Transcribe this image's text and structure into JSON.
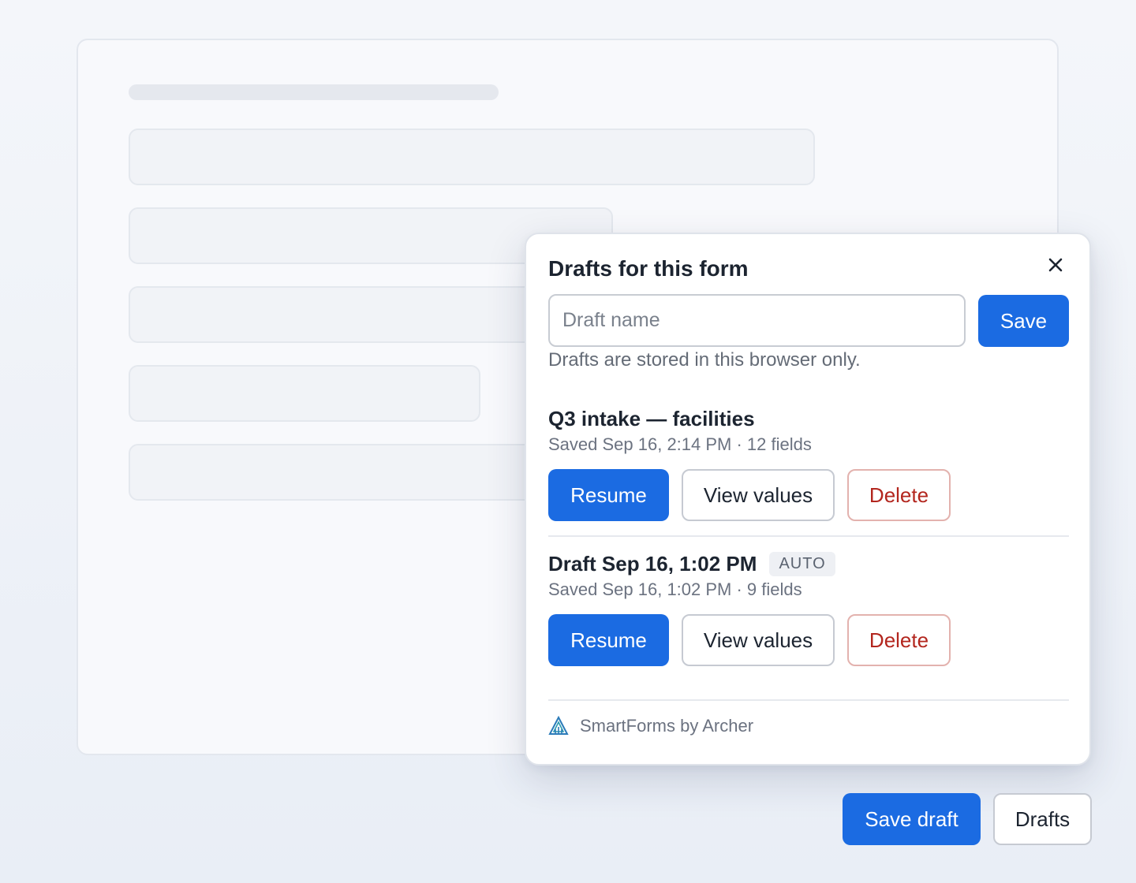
{
  "popover": {
    "title": "Drafts for this form",
    "close_label": "×",
    "input_placeholder": "Draft name",
    "save_label": "Save",
    "hint": "Drafts are stored in this browser only."
  },
  "drafts": [
    {
      "name": "Q3 intake — facilities",
      "meta": "Saved Sep 16, 2:14 PM · 12 fields",
      "resume_label": "Resume",
      "view_label": "View values",
      "delete_label": "Delete"
    },
    {
      "name": "Draft Sep 16, 1:02 PM",
      "badge": "AUTO",
      "meta": "Saved Sep 16, 1:02 PM · 9 fields",
      "resume_label": "Resume",
      "view_label": "View values",
      "delete_label": "Delete"
    }
  ],
  "footer": {
    "brand_text": "SmartForms by Archer",
    "icon": "archer-logo-icon"
  },
  "actions": {
    "save_draft_label": "Save draft",
    "drafts_label": "Drafts"
  },
  "colors": {
    "primary": "#1b6be2",
    "danger": "#b3261e"
  }
}
